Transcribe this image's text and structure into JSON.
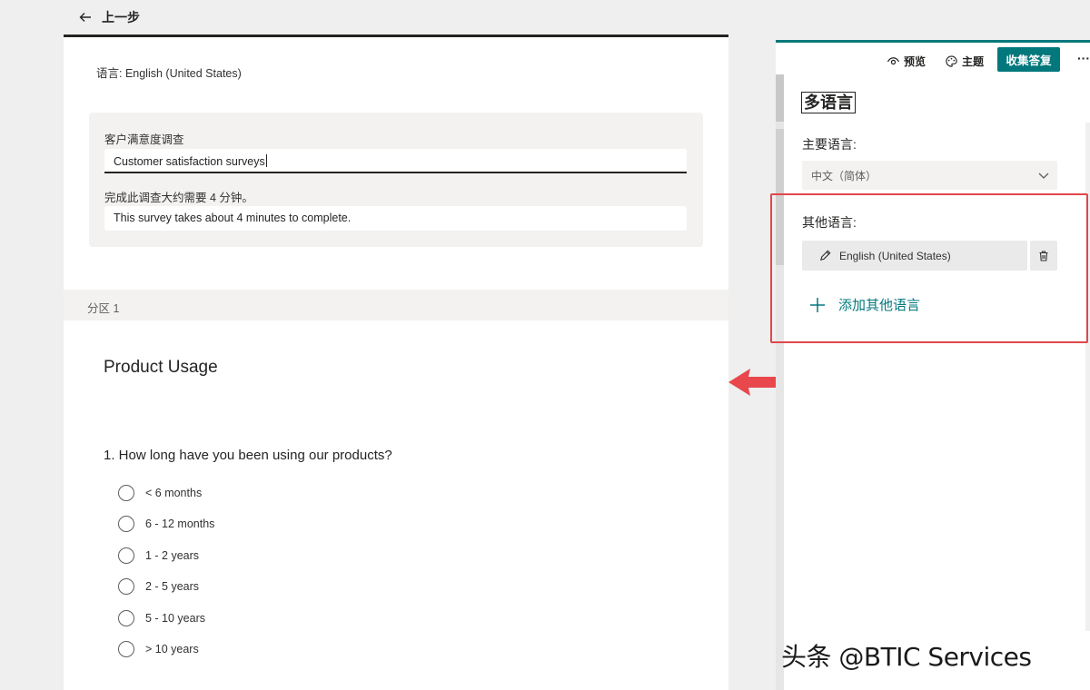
{
  "back": {
    "label": "上一步"
  },
  "form": {
    "language_line": "语言:  English (United States)",
    "title_label": "客户满意度调查",
    "title_value": "Customer satisfaction surveys",
    "desc_label": "完成此调查大约需要 4 分钟。",
    "desc_value": "This survey takes about 4 minutes to complete.",
    "section_label": "分区 1",
    "section_title": "Product Usage",
    "question": "1. How long have you been using our products?",
    "options": [
      "< 6 months",
      "6 - 12 months",
      "1 - 2 years",
      "2 - 5 years",
      "5 - 10 years",
      "> 10 years"
    ]
  },
  "toolbar": {
    "preview": "预览",
    "theme": "主题",
    "collect": "收集答复",
    "more": "···"
  },
  "panel": {
    "title": "多语言",
    "primary_label": "主要语言:",
    "primary_value": "中文（简体）",
    "other_label": "其他语言:",
    "other_item": "English (United States)",
    "add_label": "添加其他语言"
  },
  "watermark": "头条 @BTIC Services",
  "colors": {
    "accent": "#03787c",
    "highlight": "#e0474c",
    "arrow": "#e8474c"
  }
}
